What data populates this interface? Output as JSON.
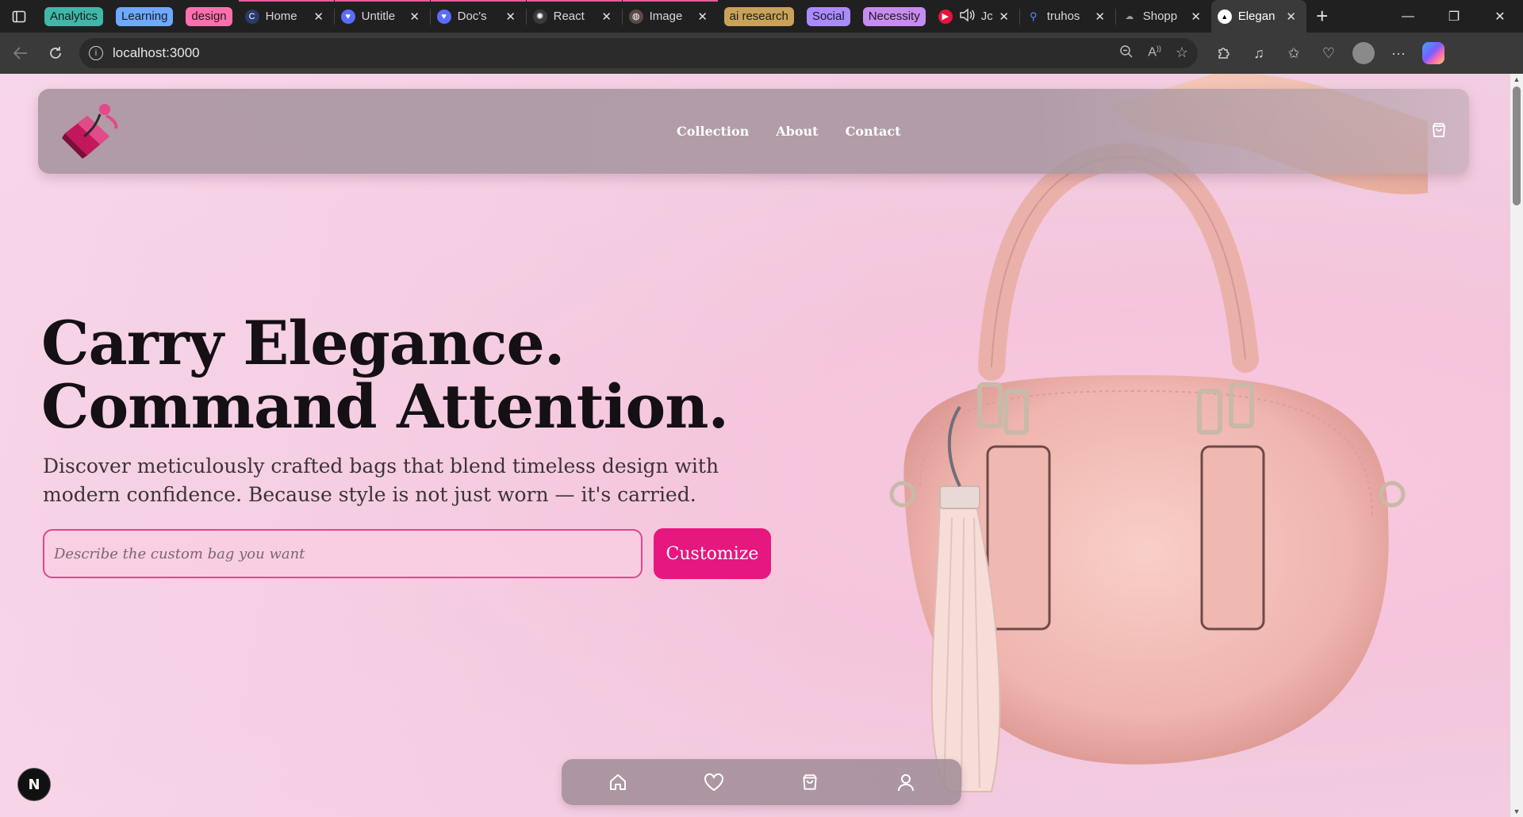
{
  "browser": {
    "tab_groups": [
      {
        "label": "Analytics",
        "color": "#3fb7a9"
      },
      {
        "label": "Learning",
        "color": "#6ea8ff"
      },
      {
        "label": "design",
        "color": "#ff6fae"
      },
      {
        "label": "ai research",
        "color": "#c9a25a"
      },
      {
        "label": "Social",
        "color": "#a98bff"
      },
      {
        "label": "Necessity",
        "color": "#c88cf0"
      }
    ],
    "tabs": [
      {
        "title": "Home",
        "icon": "circle-c-icon"
      },
      {
        "title": "Untitle",
        "icon": "heart-app-icon"
      },
      {
        "title": "Doc's",
        "icon": "heart-app-icon"
      },
      {
        "title": "React",
        "icon": "openai-icon"
      },
      {
        "title": "Image",
        "icon": "globe-icon"
      },
      {
        "title": "Jc",
        "icon": "youtube-music-icon"
      },
      {
        "title": "truhos",
        "icon": "search-icon"
      },
      {
        "title": "Shopp",
        "icon": "cloud-icon"
      },
      {
        "title": "Elegan",
        "icon": "triangle-icon"
      }
    ],
    "url": "localhost:3000"
  },
  "site": {
    "nav": {
      "links": [
        "Collection",
        "About",
        "Contact"
      ]
    },
    "hero": {
      "headline_line1": "Carry Elegance.",
      "headline_line2": "Command Attention.",
      "subtitle": "Discover meticulously crafted bags that blend timeless design with modern confidence. Because style is not just worn — it's carried.",
      "input_placeholder": "Describe the custom bag you want",
      "button_label": "Customize"
    },
    "accent_color": "#e6177e",
    "dev_badge": "N"
  }
}
